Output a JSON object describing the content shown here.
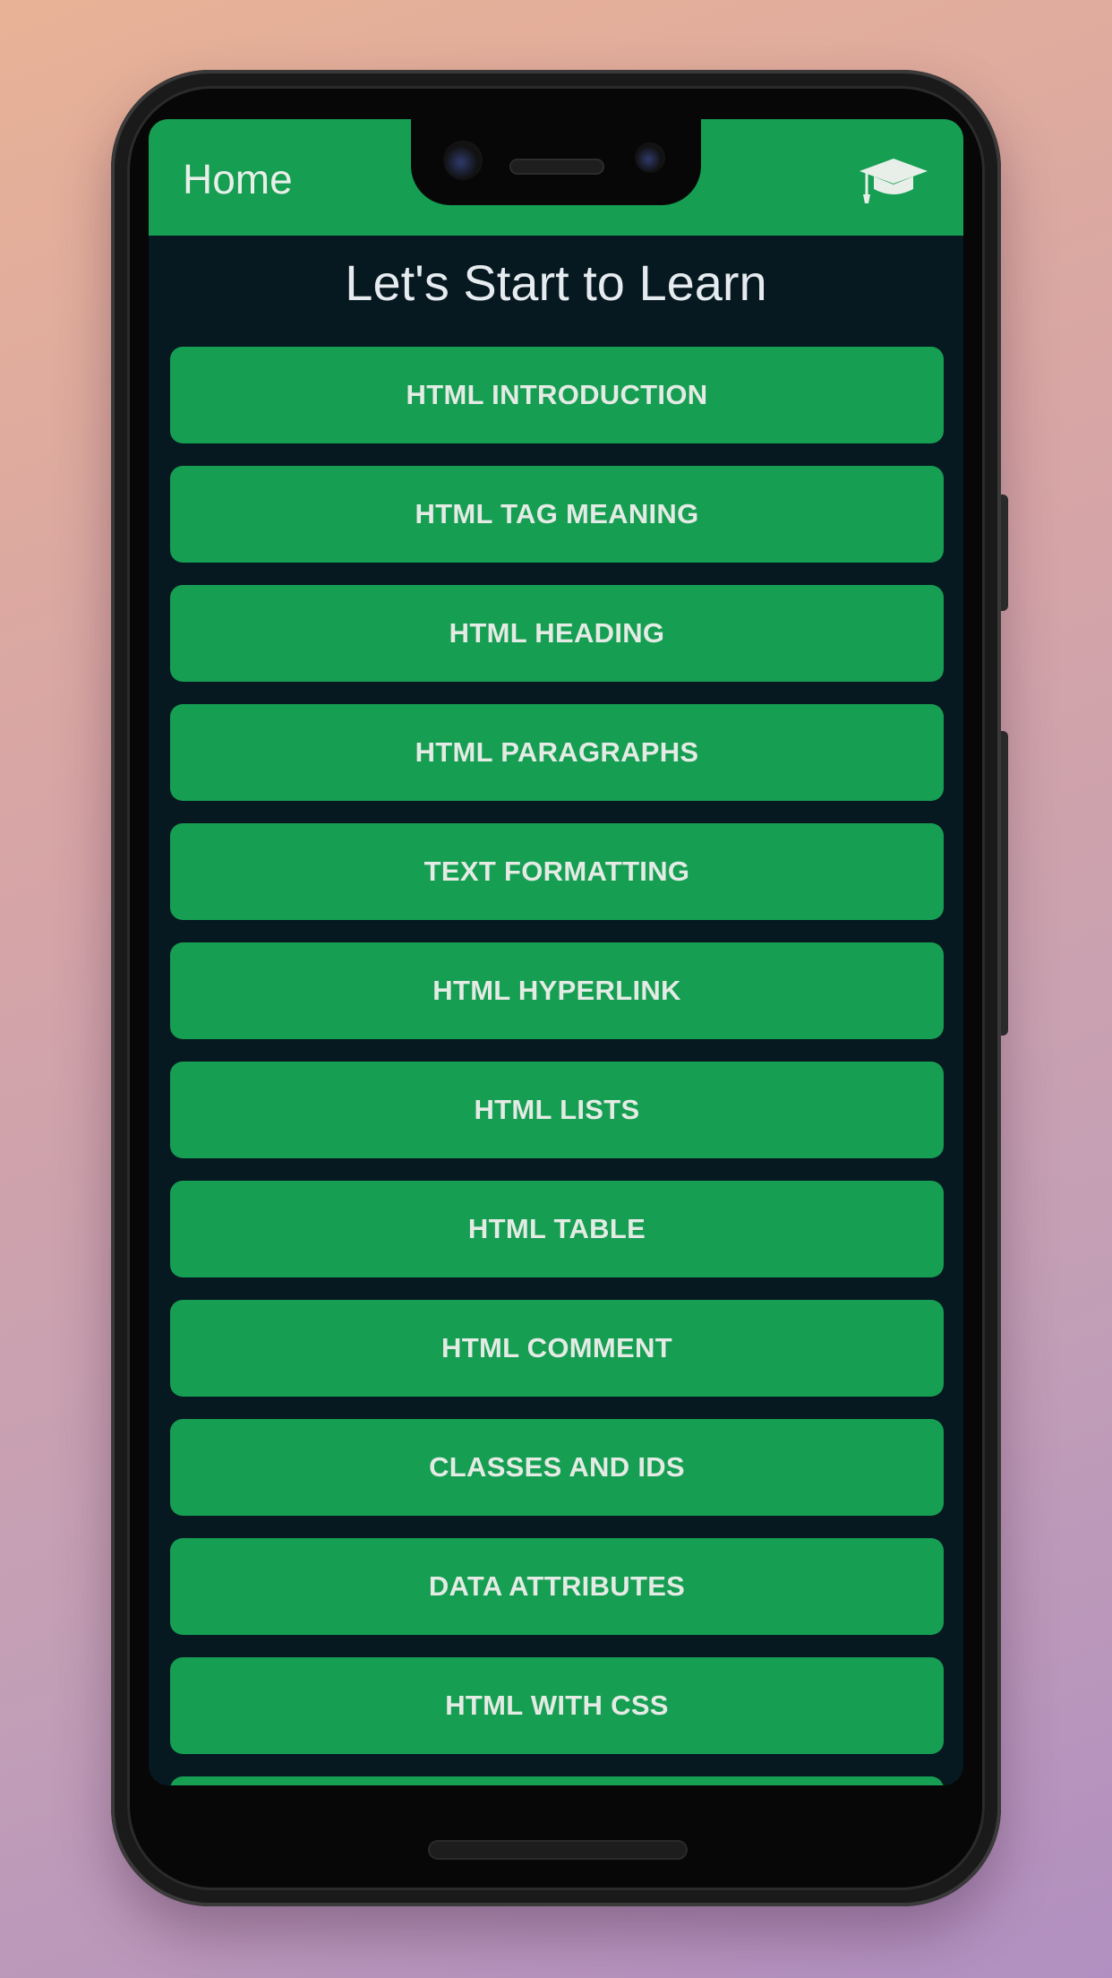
{
  "appbar": {
    "title": "Home",
    "icon": "graduation-cap-icon"
  },
  "main": {
    "heading": "Let's Start to Learn",
    "items": [
      {
        "label": "HTML INTRODUCTION"
      },
      {
        "label": "HTML TAG MEANING"
      },
      {
        "label": "HTML HEADING"
      },
      {
        "label": "HTML PARAGRAPHS"
      },
      {
        "label": "TEXT FORMATTING"
      },
      {
        "label": "HTML HYPERLINK"
      },
      {
        "label": "HTML LISTS"
      },
      {
        "label": "HTML TABLE"
      },
      {
        "label": "HTML COMMENT"
      },
      {
        "label": "CLASSES AND IDS"
      },
      {
        "label": "DATA ATTRIBUTES"
      },
      {
        "label": "HTML WITH CSS"
      },
      {
        "label": ""
      }
    ]
  },
  "colors": {
    "accent": "#169e52",
    "screen_background": "#061820",
    "text_light": "#e3ebe4"
  }
}
